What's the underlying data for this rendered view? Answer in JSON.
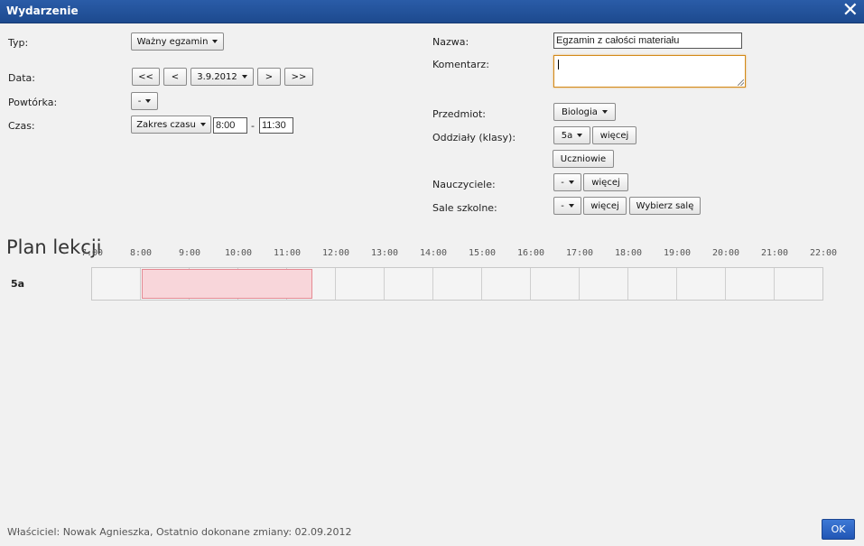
{
  "window": {
    "title": "Wydarzenie",
    "close_glyph": "✕"
  },
  "left": {
    "type_label": "Typ:",
    "type_value": "Ważny egzamin",
    "date_label": "Data:",
    "date_first": "<<",
    "date_prev": "<",
    "date_value": "3.9.2012",
    "date_next": ">",
    "date_last": ">>",
    "repeat_label": "Powtórka:",
    "repeat_value": "-",
    "time_label": "Czas:",
    "time_mode": "Zakres czasu",
    "time_from": "8:00",
    "time_sep": "-",
    "time_to": "11:30"
  },
  "right": {
    "name_label": "Nazwa:",
    "name_value": "Egzamin z całości materiału",
    "comment_label": "Komentarz:",
    "comment_value": "",
    "subject_label": "Przedmiot:",
    "subject_value": "Biologia",
    "classes_label": "Oddziały (klasy):",
    "classes_value": "5a",
    "more_label": "więcej",
    "students_button": "Uczniowie",
    "teachers_label": "Nauczyciele:",
    "teachers_value": "-",
    "rooms_label": "Sale szkolne:",
    "rooms_value": "-",
    "choose_room": "Wybierz salę"
  },
  "plan": {
    "title": "Plan lekcji",
    "hours": [
      "7:00",
      "8:00",
      "9:00",
      "10:00",
      "11:00",
      "12:00",
      "13:00",
      "14:00",
      "15:00",
      "16:00",
      "17:00",
      "18:00",
      "19:00",
      "20:00",
      "21:00",
      "22:00"
    ],
    "rows": [
      {
        "label": "5a",
        "events": [
          {
            "start": 8.0,
            "end": 11.5,
            "color": "#f8d6da"
          }
        ]
      }
    ]
  },
  "footer": {
    "info": "Właściciel: Nowak Agnieszka, Ostatnio dokonane zmiany: 02.09.2012",
    "ok_label": "OK"
  },
  "colors": {
    "titlebar": "#2a5ca8",
    "event_fill": "#f8d6da",
    "event_border": "#e58a93",
    "ok_button": "#2f68c8"
  }
}
